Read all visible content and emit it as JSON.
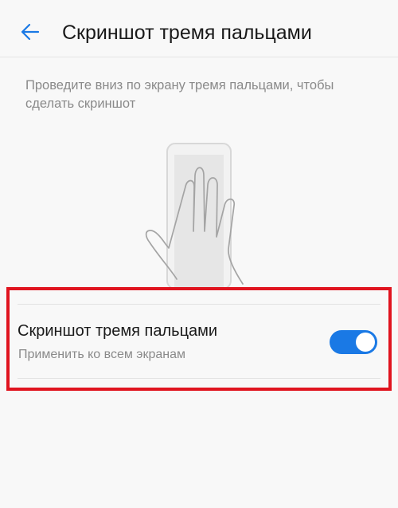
{
  "header": {
    "title": "Скриншот тремя пальцами",
    "back_icon": "arrow-left-icon"
  },
  "description": "Проведите вниз по экрану тремя пальцами, чтобы сделать скриншот",
  "illustration_icon": "three-finger-swipe-illustration",
  "setting": {
    "title": "Скриншот тремя пальцами",
    "subtitle": "Применить ко всем экранам",
    "enabled": true
  },
  "colors": {
    "accent": "#1a79e5",
    "highlight": "#e0141f",
    "background": "#f8f8f8"
  }
}
